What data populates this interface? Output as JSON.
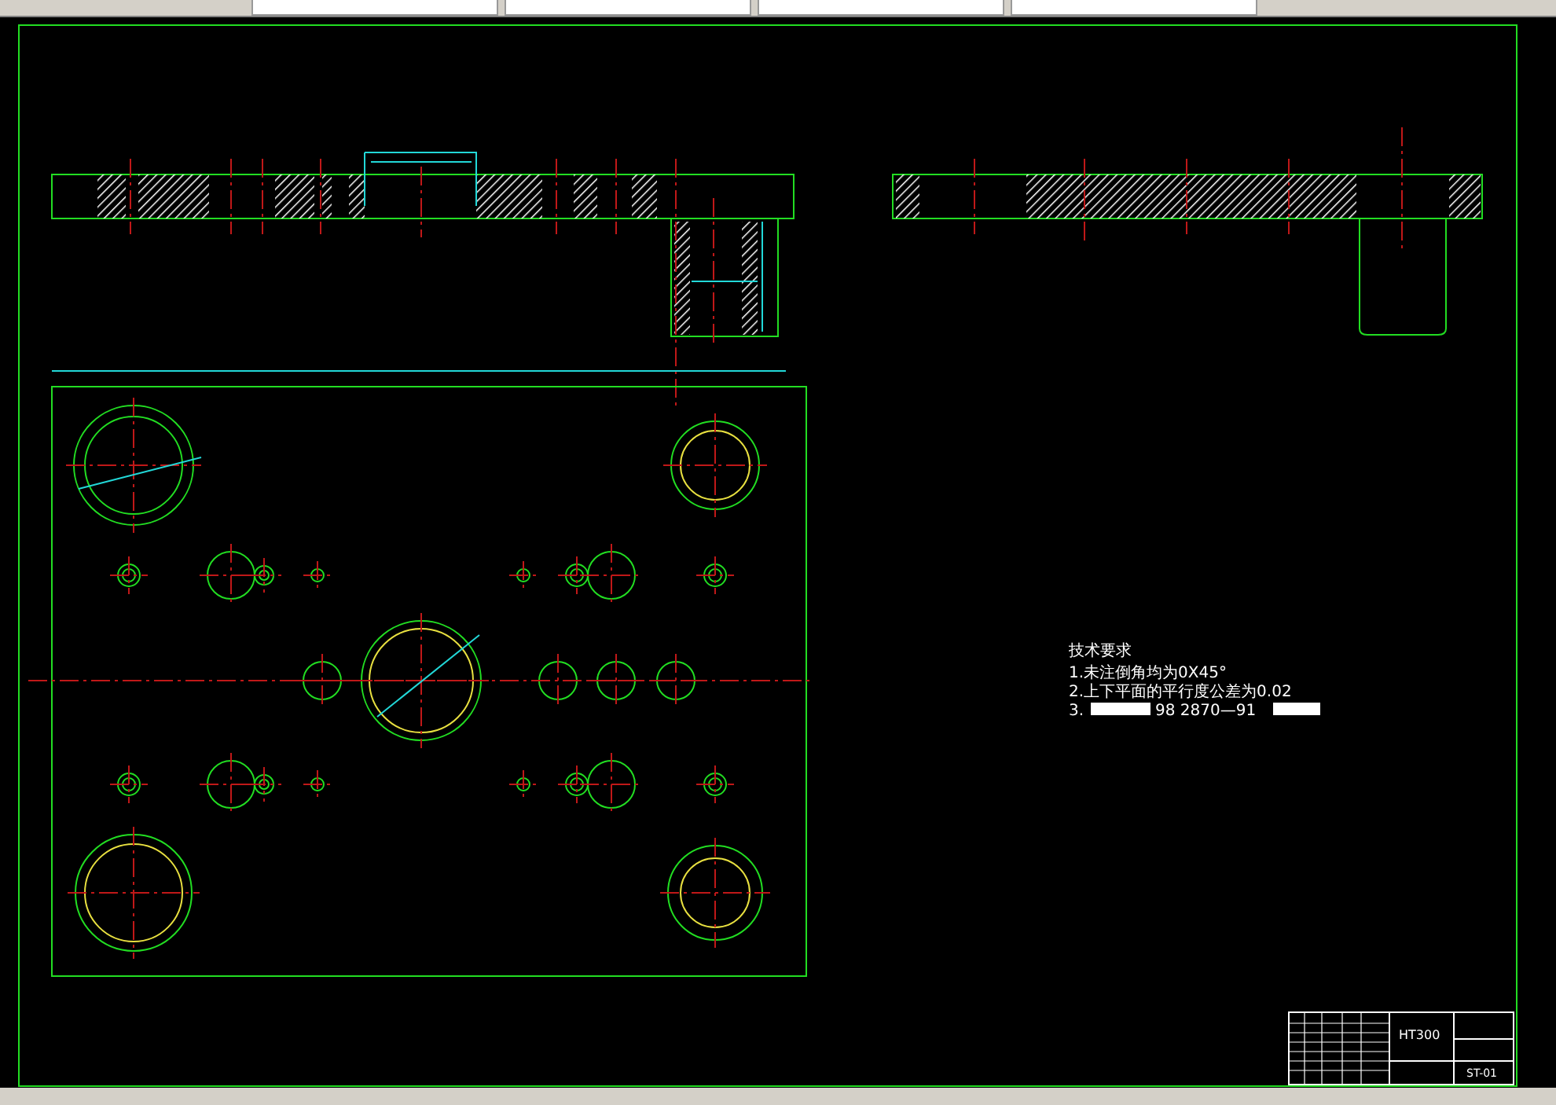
{
  "notes": {
    "title": "技术要求",
    "lines": [
      {
        "kind": "plain",
        "text": "1.未注倒角均为0X45°"
      },
      {
        "kind": "plain",
        "text": "2.上下平面的平行度公差为0.02"
      },
      {
        "kind": "masked",
        "prefix": "3.",
        "text": "98  2870—91"
      }
    ]
  },
  "title_block": {
    "material": "HT300",
    "drawing_number": "ST-01"
  }
}
